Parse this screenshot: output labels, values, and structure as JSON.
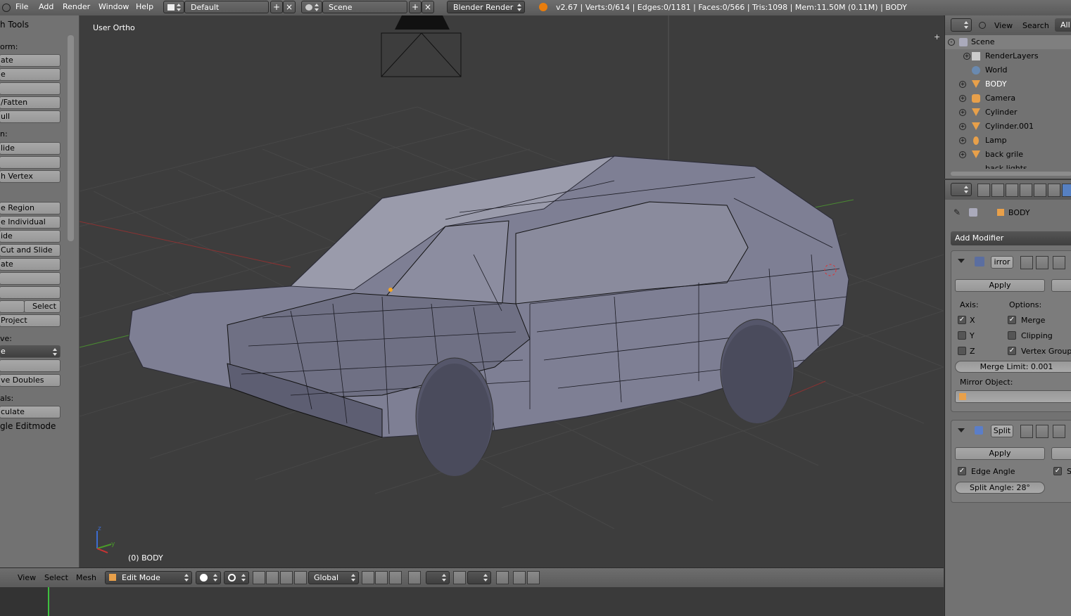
{
  "top_menu": [
    "File",
    "Add",
    "Render",
    "Window",
    "Help"
  ],
  "screen_layout": "Default",
  "scene": "Scene",
  "render_engine": "Blender Render",
  "stats": "v2.67 | Verts:0/614 | Edges:0/1181 | Faces:0/566 | Tris:1098 | Mem:11.50M (0.11M) | BODY",
  "toolshelf": {
    "title": "h Tools",
    "transform_label": "orm:",
    "transform_buttons": [
      "ate",
      "e",
      "",
      "/Fatten",
      "ull"
    ],
    "edit_label": "n:",
    "edit_buttons": [
      "lide",
      "",
      "h Vertex"
    ],
    "extrude_buttons": [
      "e Region",
      "e Individual",
      "ide",
      "Cut and Slide",
      "ate",
      "",
      ""
    ],
    "select_button": "Select",
    "project_button": "Project",
    "remove_label": "ve:",
    "remove_dropdown": "e",
    "remove_doubles_button": "ve Doubles",
    "normals_label": "als:",
    "normals_button": "culate",
    "toggle_editmode": "gle Editmode"
  },
  "viewport": {
    "title": "User Ortho",
    "object_label": "(0) BODY"
  },
  "view3d_header": {
    "menus": [
      "View",
      "Select",
      "Mesh"
    ],
    "mode": "Edit Mode",
    "orientation": "Global"
  },
  "outliner": {
    "menus": [
      "View",
      "Search"
    ],
    "filter": "All",
    "items": [
      {
        "label": "Scene",
        "icon": "scene-icon"
      },
      {
        "label": "RenderLayers",
        "icon": "renderlayers-icon"
      },
      {
        "label": "World",
        "icon": "world-icon"
      },
      {
        "label": "BODY",
        "icon": "mesh-object-icon"
      },
      {
        "label": "Camera",
        "icon": "camera-icon"
      },
      {
        "label": "Cylinder",
        "icon": "mesh-object-icon"
      },
      {
        "label": "Cylinder.001",
        "icon": "mesh-object-icon"
      },
      {
        "label": "Lamp",
        "icon": "lamp-icon"
      },
      {
        "label": "back grile",
        "icon": "mesh-object-icon"
      },
      {
        "label": "back lights",
        "icon": "mesh-object-icon"
      }
    ]
  },
  "properties": {
    "object_name": "BODY",
    "add_modifier": "Add Modifier",
    "mirror": {
      "name": "irror",
      "apply": "Apply",
      "axis_label": "Axis:",
      "options_label": "Options:",
      "axes": [
        {
          "label": "X",
          "checked": true
        },
        {
          "label": "Y",
          "checked": false
        },
        {
          "label": "Z",
          "checked": false
        }
      ],
      "options": [
        {
          "label": "Merge",
          "checked": true
        },
        {
          "label": "Clipping",
          "checked": false
        },
        {
          "label": "Vertex Group",
          "checked": true
        }
      ],
      "merge_limit": "Merge Limit: 0.001",
      "mirror_object_label": "Mirror Object:"
    },
    "split": {
      "name": "Split",
      "apply": "Apply",
      "edge_angle": "Edge Angle",
      "edge_angle_checked": true,
      "second_option": "S",
      "split_angle": "Split Angle: 28°"
    }
  }
}
